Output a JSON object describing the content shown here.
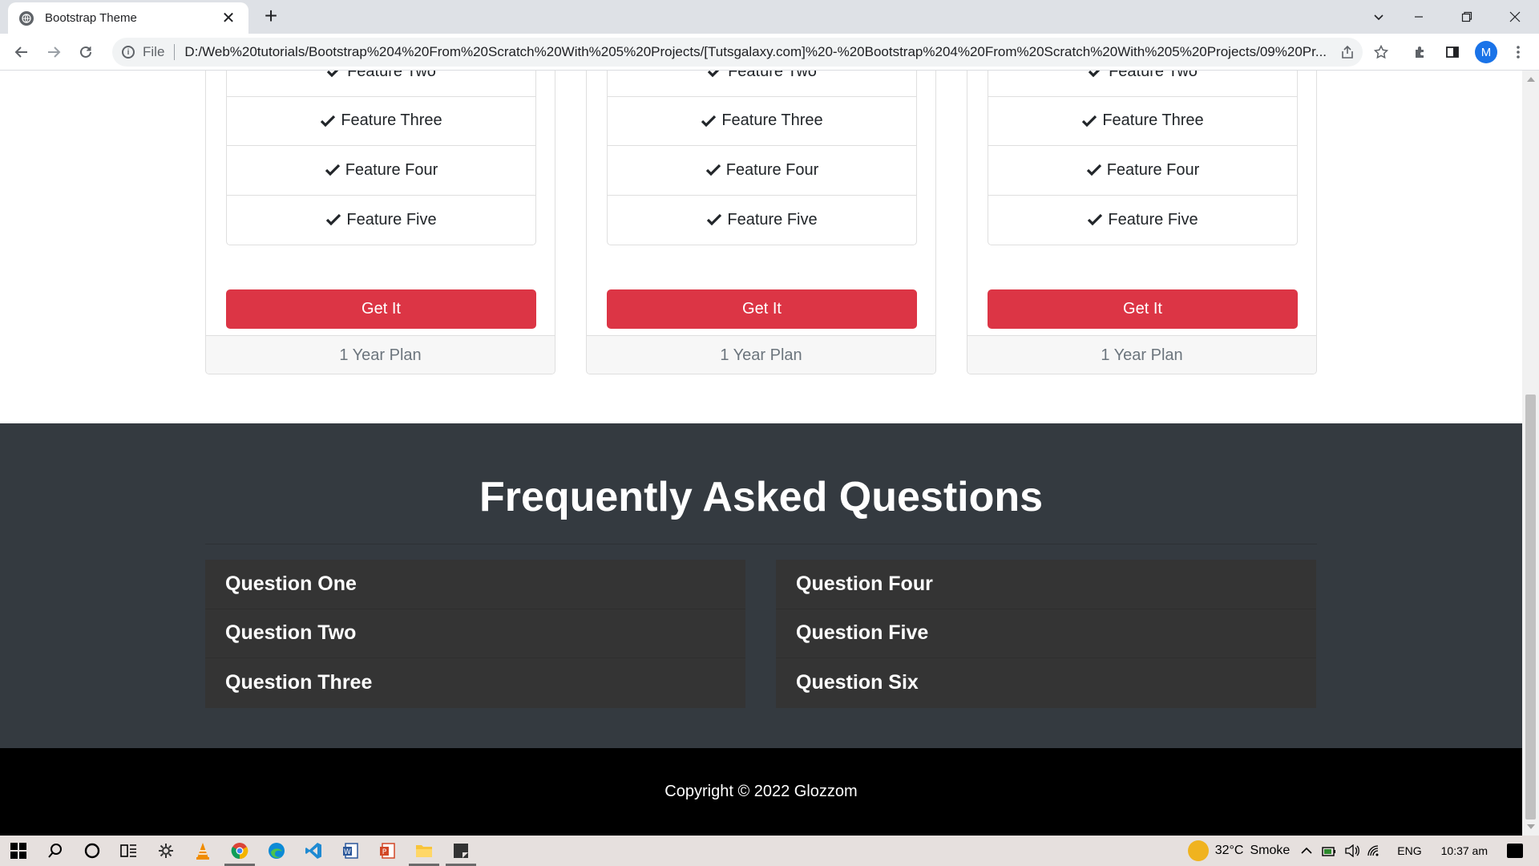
{
  "browser": {
    "tab_title": "Bootstrap Theme",
    "tab_close": "✕",
    "new_tab": "+",
    "url_scheme": "File",
    "url": "D:/Web%20tutorials/Bootstrap%204%20From%20Scratch%20With%205%20Projects/[Tutsgalaxy.com]%20-%20Bootstrap%204%20From%20Scratch%20With%205%20Projects/09%20Pr...",
    "profile_initial": "M"
  },
  "pricing": {
    "cards": [
      {
        "features": [
          "Feature Two",
          "Feature Three",
          "Feature Four",
          "Feature Five"
        ],
        "button_label": "Get It",
        "footer": "1 Year Plan"
      },
      {
        "features": [
          "Feature Two",
          "Feature Three",
          "Feature Four",
          "Feature Five"
        ],
        "button_label": "Get It",
        "footer": "1 Year Plan"
      },
      {
        "features": [
          "Feature Two",
          "Feature Three",
          "Feature Four",
          "Feature Five"
        ],
        "button_label": "Get It",
        "footer": "1 Year Plan"
      }
    ],
    "button_color": "#dc3545"
  },
  "faq": {
    "title": "Frequently Asked Questions",
    "left_questions": [
      "Question One",
      "Question Two",
      "Question Three"
    ],
    "right_questions": [
      "Question Four",
      "Question Five",
      "Question Six"
    ],
    "background_color": "#343a40"
  },
  "footer": {
    "copyright": "Copyright © 2022 Glozzom"
  },
  "taskbar": {
    "weather_temp": "32°C",
    "weather_desc": "Smoke",
    "language": "ENG",
    "time": "10:37 am"
  }
}
